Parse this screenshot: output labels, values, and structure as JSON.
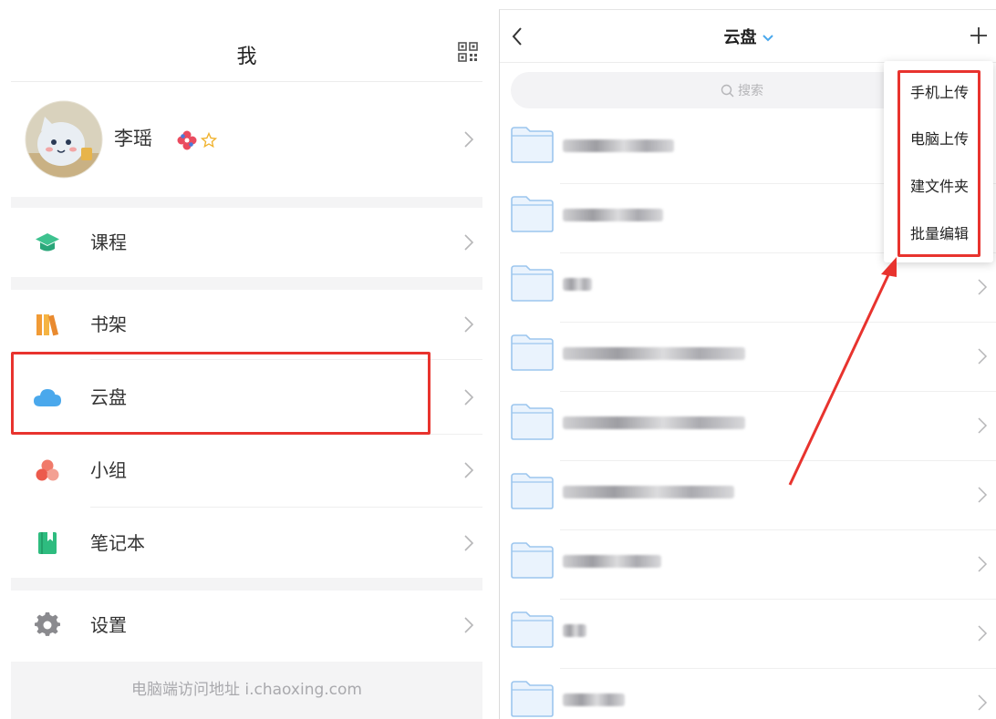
{
  "left": {
    "title": "我",
    "profile": {
      "name": "李瑶"
    },
    "menu": [
      {
        "label": "课程",
        "icon": "graduation-cap-icon",
        "color": "#3ec28f"
      },
      {
        "label": "书架",
        "icon": "bookshelf-icon",
        "color": "#f19b36"
      },
      {
        "label": "云盘",
        "icon": "cloud-icon",
        "color": "#4aa8ec"
      },
      {
        "label": "小组",
        "icon": "group-icon",
        "color": "#ef6b5c"
      },
      {
        "label": "笔记本",
        "icon": "notebook-icon",
        "color": "#2ebc7f"
      },
      {
        "label": "设置",
        "icon": "gear-icon",
        "color": "#888888"
      }
    ],
    "footer": "电脑端访问地址 i.chaoxing.com"
  },
  "right": {
    "title": "云盘",
    "search_placeholder": "搜索",
    "add_menu": [
      "手机上传",
      "电脑上传",
      "建文件夹",
      "批量编辑"
    ]
  },
  "colors": {
    "highlight": "#e8332e",
    "folder": "#9cc6ee"
  }
}
